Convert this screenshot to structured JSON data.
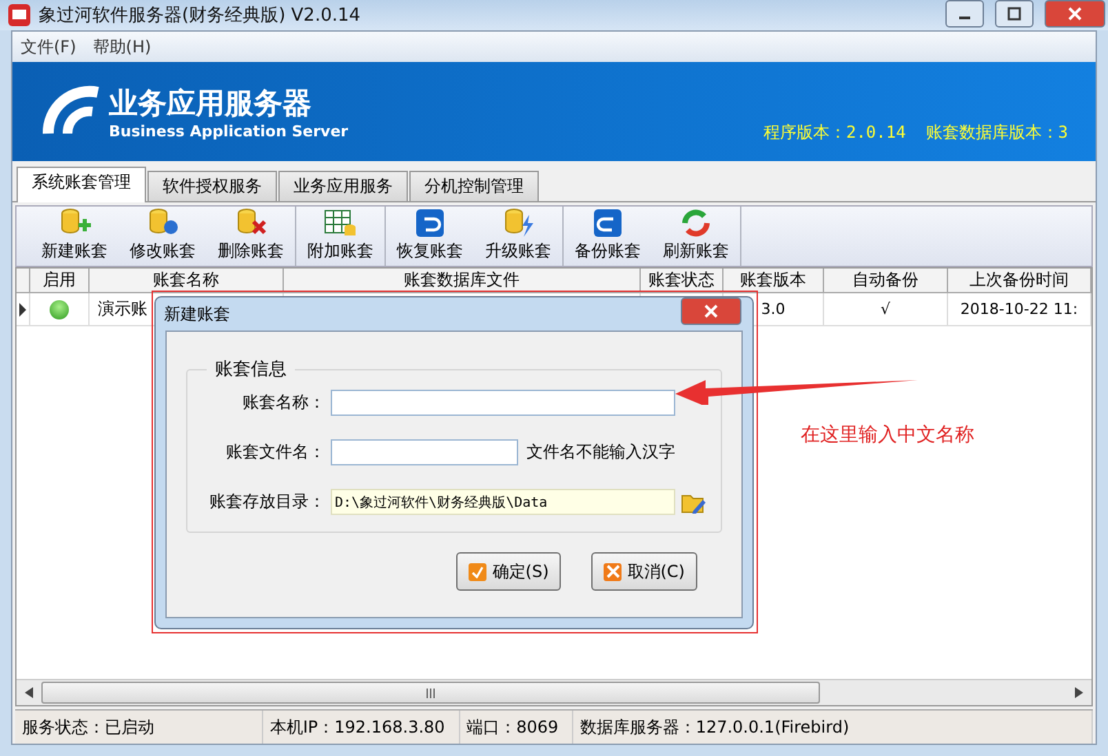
{
  "window": {
    "title": "象过河软件服务器(财务经典版) V2.0.14"
  },
  "menu": [
    "文件(F)",
    "帮助(H)"
  ],
  "banner": {
    "title": "业务应用服务器",
    "subtitle": "Business Application Server",
    "version_info": "程序版本：2.0.14  账套数据库版本：3"
  },
  "tabs": [
    {
      "label": "系统账套管理",
      "selected": true
    },
    {
      "label": "软件授权服务",
      "selected": false
    },
    {
      "label": "业务应用服务",
      "selected": false
    },
    {
      "label": "分机控制管理",
      "selected": false
    }
  ],
  "toolbar": [
    {
      "label": "新建账套",
      "kind": "add"
    },
    {
      "label": "修改账套",
      "kind": "edit"
    },
    {
      "label": "删除账套",
      "kind": "delete"
    },
    {
      "label": "附加账套",
      "kind": "attach"
    },
    {
      "label": "恢复账套",
      "kind": "restore"
    },
    {
      "label": "升级账套",
      "kind": "upgrade"
    },
    {
      "label": "备份账套",
      "kind": "backup"
    },
    {
      "label": "刷新账套",
      "kind": "refresh"
    }
  ],
  "table": {
    "columns": [
      "启用",
      "账套名称",
      "账套数据库文件",
      "账套状态",
      "账套版本",
      "自动备份",
      "上次备份时间"
    ],
    "rows": [
      {
        "enabled": true,
        "selected": true,
        "name": "演示账",
        "version": "3.0",
        "auto_backup": "√",
        "last_backup": "2018-10-22 11:"
      }
    ]
  },
  "dialog": {
    "title": "新建账套",
    "group": "账套信息",
    "fields": [
      {
        "label": "账套名称："
      },
      {
        "label": "账套文件名：",
        "note": "文件名不能输入汉字"
      },
      {
        "label": "账套存放目录：",
        "value": "D:\\象过河软件\\财务经典版\\Data"
      }
    ],
    "ok": "确定(S)",
    "cancel": "取消(C)"
  },
  "annotation": "在这里输入中文名称",
  "status_bar": [
    "服务状态：已启动",
    "本机IP：192.168.3.80",
    "端口：8069",
    "数据库服务器：127.0.0.1(Firebird)"
  ]
}
